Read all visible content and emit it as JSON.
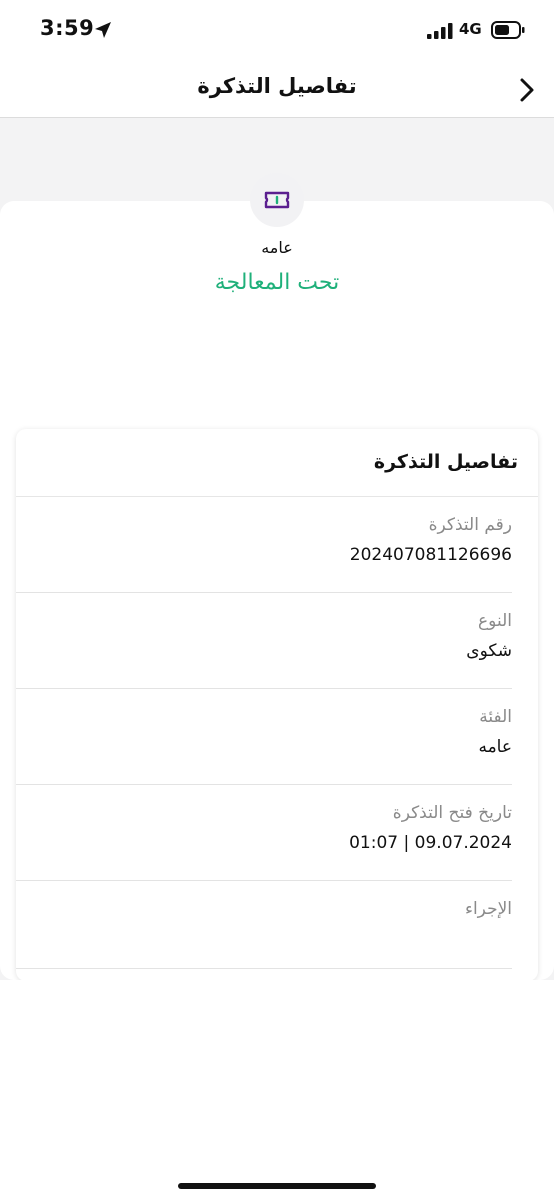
{
  "status_bar": {
    "time": "3:59",
    "network": "4G",
    "icons": [
      "location-arrow-icon",
      "signal-bars-icon",
      "battery-icon"
    ]
  },
  "nav": {
    "title": "تفاصيل التذكرة",
    "back_icon": "chevron-right-icon"
  },
  "ticket": {
    "icon": "ticket-icon",
    "category": "عامه",
    "status": "تحت المعالجة",
    "status_color": "#1fb07a",
    "accent_color": "#5b1f8f"
  },
  "details": {
    "title": "تفاصيل التذكرة",
    "rows": [
      {
        "label": "رقم التذكرة",
        "value": "202407081126696"
      },
      {
        "label": "النوع",
        "value": "شكوى"
      },
      {
        "label": "الفئة",
        "value": "عامه"
      },
      {
        "label": "تاريخ فتح التذكرة",
        "value": "09.07.2024 | 01:07"
      },
      {
        "label": "الإجراء",
        "value": ""
      }
    ]
  }
}
